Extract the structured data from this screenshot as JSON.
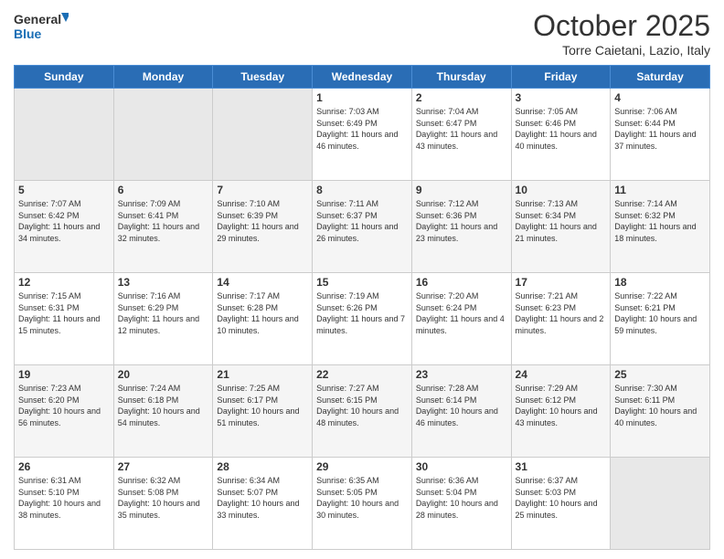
{
  "header": {
    "logo_line1": "General",
    "logo_line2": "Blue",
    "month": "October 2025",
    "location": "Torre Caietani, Lazio, Italy"
  },
  "days_of_week": [
    "Sunday",
    "Monday",
    "Tuesday",
    "Wednesday",
    "Thursday",
    "Friday",
    "Saturday"
  ],
  "weeks": [
    [
      {
        "day": "",
        "empty": true
      },
      {
        "day": "",
        "empty": true
      },
      {
        "day": "",
        "empty": true
      },
      {
        "day": "1",
        "sunrise": "7:03 AM",
        "sunset": "6:49 PM",
        "daylight": "11 hours and 46 minutes."
      },
      {
        "day": "2",
        "sunrise": "7:04 AM",
        "sunset": "6:47 PM",
        "daylight": "11 hours and 43 minutes."
      },
      {
        "day": "3",
        "sunrise": "7:05 AM",
        "sunset": "6:46 PM",
        "daylight": "11 hours and 40 minutes."
      },
      {
        "day": "4",
        "sunrise": "7:06 AM",
        "sunset": "6:44 PM",
        "daylight": "11 hours and 37 minutes."
      }
    ],
    [
      {
        "day": "5",
        "sunrise": "7:07 AM",
        "sunset": "6:42 PM",
        "daylight": "11 hours and 34 minutes."
      },
      {
        "day": "6",
        "sunrise": "7:09 AM",
        "sunset": "6:41 PM",
        "daylight": "11 hours and 32 minutes."
      },
      {
        "day": "7",
        "sunrise": "7:10 AM",
        "sunset": "6:39 PM",
        "daylight": "11 hours and 29 minutes."
      },
      {
        "day": "8",
        "sunrise": "7:11 AM",
        "sunset": "6:37 PM",
        "daylight": "11 hours and 26 minutes."
      },
      {
        "day": "9",
        "sunrise": "7:12 AM",
        "sunset": "6:36 PM",
        "daylight": "11 hours and 23 minutes."
      },
      {
        "day": "10",
        "sunrise": "7:13 AM",
        "sunset": "6:34 PM",
        "daylight": "11 hours and 21 minutes."
      },
      {
        "day": "11",
        "sunrise": "7:14 AM",
        "sunset": "6:32 PM",
        "daylight": "11 hours and 18 minutes."
      }
    ],
    [
      {
        "day": "12",
        "sunrise": "7:15 AM",
        "sunset": "6:31 PM",
        "daylight": "11 hours and 15 minutes."
      },
      {
        "day": "13",
        "sunrise": "7:16 AM",
        "sunset": "6:29 PM",
        "daylight": "11 hours and 12 minutes."
      },
      {
        "day": "14",
        "sunrise": "7:17 AM",
        "sunset": "6:28 PM",
        "daylight": "11 hours and 10 minutes."
      },
      {
        "day": "15",
        "sunrise": "7:19 AM",
        "sunset": "6:26 PM",
        "daylight": "11 hours and 7 minutes."
      },
      {
        "day": "16",
        "sunrise": "7:20 AM",
        "sunset": "6:24 PM",
        "daylight": "11 hours and 4 minutes."
      },
      {
        "day": "17",
        "sunrise": "7:21 AM",
        "sunset": "6:23 PM",
        "daylight": "11 hours and 2 minutes."
      },
      {
        "day": "18",
        "sunrise": "7:22 AM",
        "sunset": "6:21 PM",
        "daylight": "10 hours and 59 minutes."
      }
    ],
    [
      {
        "day": "19",
        "sunrise": "7:23 AM",
        "sunset": "6:20 PM",
        "daylight": "10 hours and 56 minutes."
      },
      {
        "day": "20",
        "sunrise": "7:24 AM",
        "sunset": "6:18 PM",
        "daylight": "10 hours and 54 minutes."
      },
      {
        "day": "21",
        "sunrise": "7:25 AM",
        "sunset": "6:17 PM",
        "daylight": "10 hours and 51 minutes."
      },
      {
        "day": "22",
        "sunrise": "7:27 AM",
        "sunset": "6:15 PM",
        "daylight": "10 hours and 48 minutes."
      },
      {
        "day": "23",
        "sunrise": "7:28 AM",
        "sunset": "6:14 PM",
        "daylight": "10 hours and 46 minutes."
      },
      {
        "day": "24",
        "sunrise": "7:29 AM",
        "sunset": "6:12 PM",
        "daylight": "10 hours and 43 minutes."
      },
      {
        "day": "25",
        "sunrise": "7:30 AM",
        "sunset": "6:11 PM",
        "daylight": "10 hours and 40 minutes."
      }
    ],
    [
      {
        "day": "26",
        "sunrise": "6:31 AM",
        "sunset": "5:10 PM",
        "daylight": "10 hours and 38 minutes."
      },
      {
        "day": "27",
        "sunrise": "6:32 AM",
        "sunset": "5:08 PM",
        "daylight": "10 hours and 35 minutes."
      },
      {
        "day": "28",
        "sunrise": "6:34 AM",
        "sunset": "5:07 PM",
        "daylight": "10 hours and 33 minutes."
      },
      {
        "day": "29",
        "sunrise": "6:35 AM",
        "sunset": "5:05 PM",
        "daylight": "10 hours and 30 minutes."
      },
      {
        "day": "30",
        "sunrise": "6:36 AM",
        "sunset": "5:04 PM",
        "daylight": "10 hours and 28 minutes."
      },
      {
        "day": "31",
        "sunrise": "6:37 AM",
        "sunset": "5:03 PM",
        "daylight": "10 hours and 25 minutes."
      },
      {
        "day": "",
        "empty": true
      }
    ]
  ]
}
